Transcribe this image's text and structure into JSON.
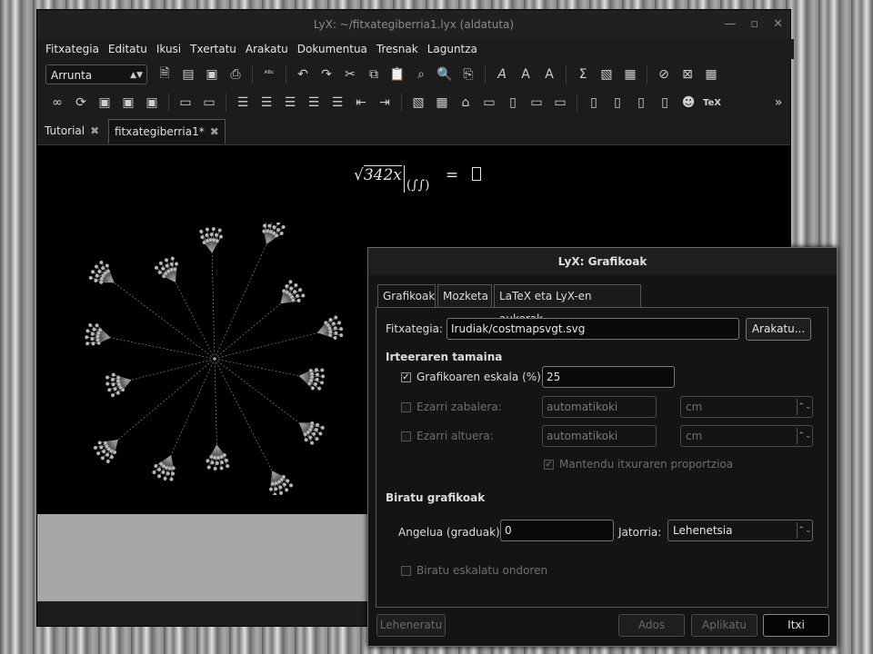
{
  "window": {
    "title": "LyX: ~/fitxategiberria1.lyx (aldatuta)"
  },
  "menubar": [
    "Fitxategia",
    "Editatu",
    "Ikusi",
    "Txertatu",
    "Arakatu",
    "Dokumentua",
    "Tresnak",
    "Laguntza"
  ],
  "toolbar": {
    "paragraph_style": "Arrunta",
    "overflow": "»"
  },
  "tabs": [
    {
      "label": "Tutorial",
      "active": false
    },
    {
      "label": "fitxategiberria1*",
      "active": true
    }
  ],
  "document": {
    "math_radicand": "342x",
    "math_paren": "(∫∫)",
    "math_equals": "="
  },
  "dialog": {
    "title": "LyX: Grafikoak",
    "tabs": [
      "Grafikoak",
      "Mozketa",
      "LaTeX eta LyX-en aukerak"
    ],
    "file_label": "Fitxategia:",
    "file_value": "Irudiak/costmapsvgt.svg",
    "browse_button": "Arakatu...",
    "output_size_header": "Irteeraren tamaina",
    "scale_label": "Grafikoaren eskala (%):",
    "scale_checked": true,
    "scale_value": "25",
    "width_label": "Ezarri zabalera:",
    "width_value": "automatikoki",
    "width_unit": "cm",
    "height_label": "Ezarri altuera:",
    "height_value": "automatikoki",
    "height_unit": "cm",
    "keep_aspect_label": "Mantendu itxuraren proportzioa",
    "keep_aspect_checked": true,
    "rotate_header": "Biratu grafikoak",
    "angle_label": "Angelua (graduak):",
    "angle_value": "0",
    "origin_label": "Jatorria:",
    "origin_value": "Lehenetsia",
    "rotate_after_label": "Biratu eskalatu ondoren",
    "rotate_after_checked": false,
    "restore_button": "Leheneratu",
    "ok_button": "Ados",
    "apply_button": "Aplikatu",
    "close_button": "Itxi"
  }
}
